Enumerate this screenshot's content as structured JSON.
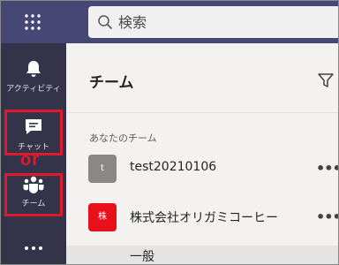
{
  "search": {
    "placeholder": "検索"
  },
  "rail": {
    "items": [
      {
        "label": "アクティビティ",
        "icon": "bell-icon"
      },
      {
        "label": "チャット",
        "icon": "chat-icon"
      },
      {
        "label": "チーム",
        "icon": "teams-icon"
      },
      {
        "label": "",
        "icon": "more-icon"
      }
    ]
  },
  "annotation": {
    "or_label": "or",
    "highlight_color": "#e1192d"
  },
  "panel": {
    "title": "チーム",
    "section_label": "あなたのチーム",
    "teams": [
      {
        "name": "test20210106",
        "avatar_text": "t",
        "avatar_color": "#8a8886"
      },
      {
        "name": "株式会社オリガミコーヒー",
        "avatar_text": "株",
        "avatar_color": "#e8101b"
      }
    ],
    "channel": {
      "name": "一般"
    },
    "more_label": "•••"
  },
  "colors": {
    "topbar": "#464775",
    "rail": "#33344a",
    "panel": "#f3f2f1"
  }
}
